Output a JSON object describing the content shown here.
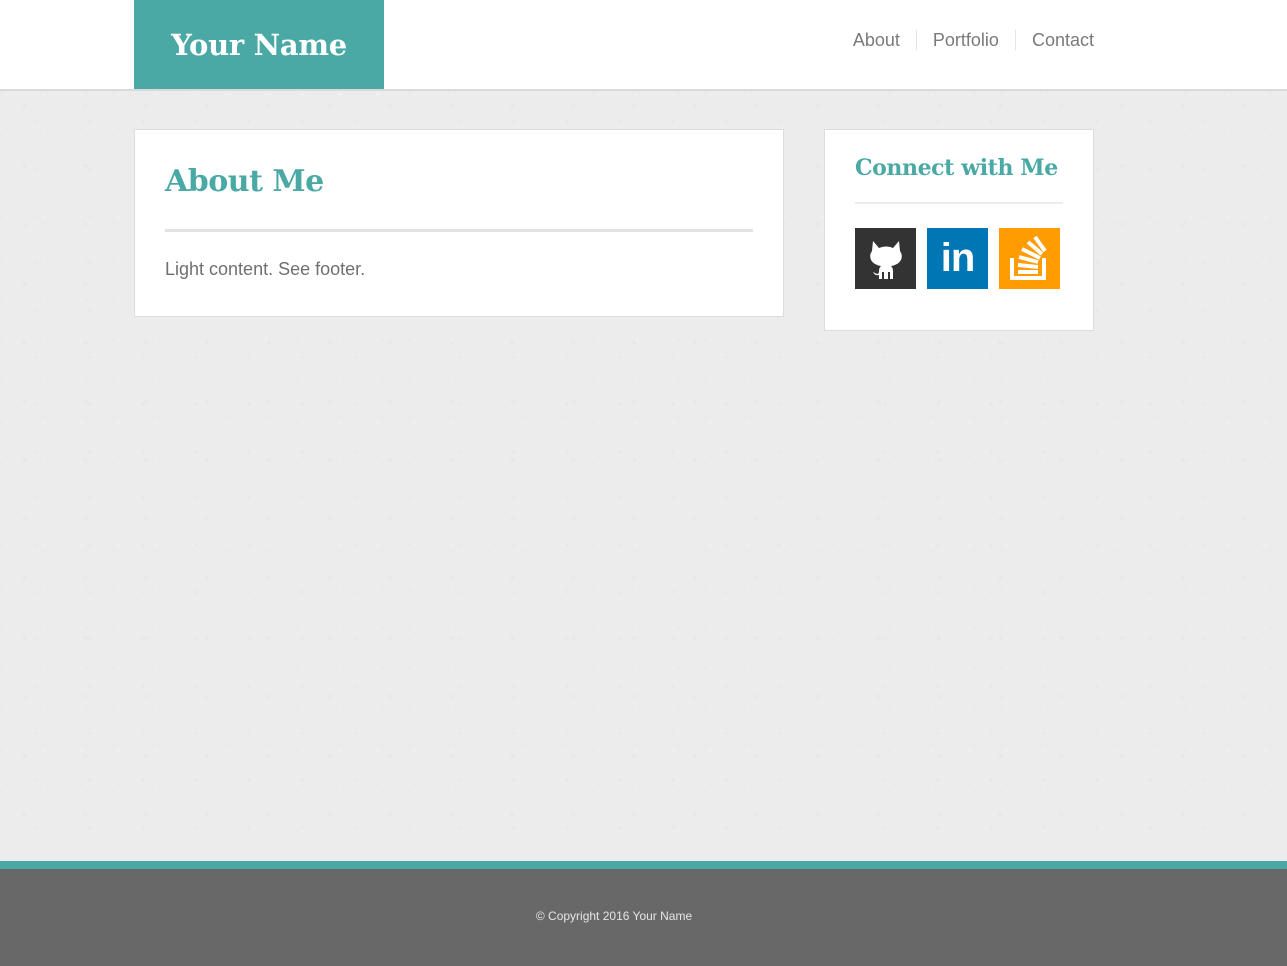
{
  "header": {
    "brand": "Your Name",
    "nav": [
      "About",
      "Portfolio",
      "Contact"
    ]
  },
  "main": {
    "title": "About Me",
    "body": "Light content. See footer."
  },
  "sidebar": {
    "title": "Connect with Me",
    "social": [
      {
        "name": "github",
        "icon": "github-icon",
        "color": "#333333"
      },
      {
        "name": "linkedin",
        "icon": "linkedin-icon",
        "glyph": "in",
        "color": "#0077b5"
      },
      {
        "name": "stackoverflow",
        "icon": "stackoverflow-icon",
        "color": "#fe9c02"
      }
    ]
  },
  "footer": {
    "copyright": "© Copyright 2016 Your Name"
  },
  "colors": {
    "accent": "#4aa9a4",
    "footer_bg": "#686868",
    "page_bg": "#ececec"
  }
}
